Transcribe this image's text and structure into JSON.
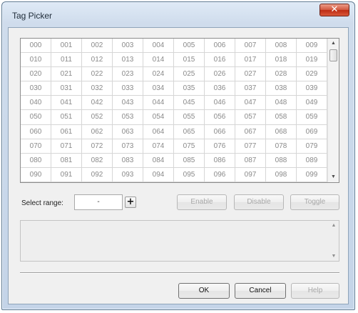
{
  "window": {
    "title": "Tag Picker",
    "close_glyph": "✕"
  },
  "grid": {
    "rows": [
      [
        "000",
        "001",
        "002",
        "003",
        "004",
        "005",
        "006",
        "007",
        "008",
        "009"
      ],
      [
        "010",
        "011",
        "012",
        "013",
        "014",
        "015",
        "016",
        "017",
        "018",
        "019"
      ],
      [
        "020",
        "021",
        "022",
        "023",
        "024",
        "025",
        "026",
        "027",
        "028",
        "029"
      ],
      [
        "030",
        "031",
        "032",
        "033",
        "034",
        "035",
        "036",
        "037",
        "038",
        "039"
      ],
      [
        "040",
        "041",
        "042",
        "043",
        "044",
        "045",
        "046",
        "047",
        "048",
        "049"
      ],
      [
        "050",
        "051",
        "052",
        "053",
        "054",
        "055",
        "056",
        "057",
        "058",
        "059"
      ],
      [
        "060",
        "061",
        "062",
        "063",
        "064",
        "065",
        "066",
        "067",
        "068",
        "069"
      ],
      [
        "070",
        "071",
        "072",
        "073",
        "074",
        "075",
        "076",
        "077",
        "078",
        "079"
      ],
      [
        "080",
        "081",
        "082",
        "083",
        "084",
        "085",
        "086",
        "087",
        "088",
        "089"
      ],
      [
        "090",
        "091",
        "092",
        "093",
        "094",
        "095",
        "096",
        "097",
        "098",
        "099"
      ]
    ],
    "scroll_up_glyph": "▲",
    "scroll_down_glyph": "▼"
  },
  "range": {
    "label": "Select range:",
    "value": "-",
    "add_glyph": "+"
  },
  "actions": {
    "enable": "Enable",
    "disable": "Disable",
    "toggle": "Toggle"
  },
  "log": {
    "scroll_up_glyph": "▲",
    "scroll_down_glyph": "▼"
  },
  "footer": {
    "ok": "OK",
    "cancel": "Cancel",
    "help": "Help"
  },
  "icons": {
    "close": "close-icon",
    "add": "plus-icon",
    "scroll_up": "chevron-up-icon",
    "scroll_down": "chevron-down-icon"
  },
  "colors": {
    "close_button": "#c8381e",
    "frame": "#c4d4e8",
    "cell_text": "#8a8a8a"
  }
}
